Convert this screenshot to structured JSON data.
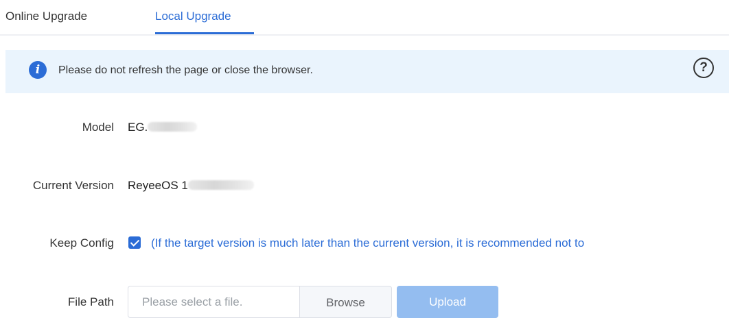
{
  "tabs": [
    {
      "label": "Online Upgrade",
      "active": false
    },
    {
      "label": "Local Upgrade",
      "active": true
    }
  ],
  "banner": {
    "icon": "info-icon",
    "message": "Please do not refresh the page or close the browser.",
    "help_icon": "question-circle-icon",
    "help_glyph": "?"
  },
  "form": {
    "model": {
      "label": "Model",
      "value": "EG."
    },
    "current_version": {
      "label": "Current Version",
      "value": "ReyeeOS 1"
    },
    "keep_config": {
      "label": "Keep Config",
      "checked": true,
      "note": "(If the target version is much later than the current version, it is recommended not to"
    },
    "file_path": {
      "label": "File Path",
      "placeholder": "Please select a file.",
      "value": "",
      "browse_label": "Browse",
      "upload_label": "Upload"
    }
  },
  "colors": {
    "accent": "#2b6cd6",
    "banner_bg": "#eaf4fd",
    "upload_disabled": "#94bdf0"
  }
}
